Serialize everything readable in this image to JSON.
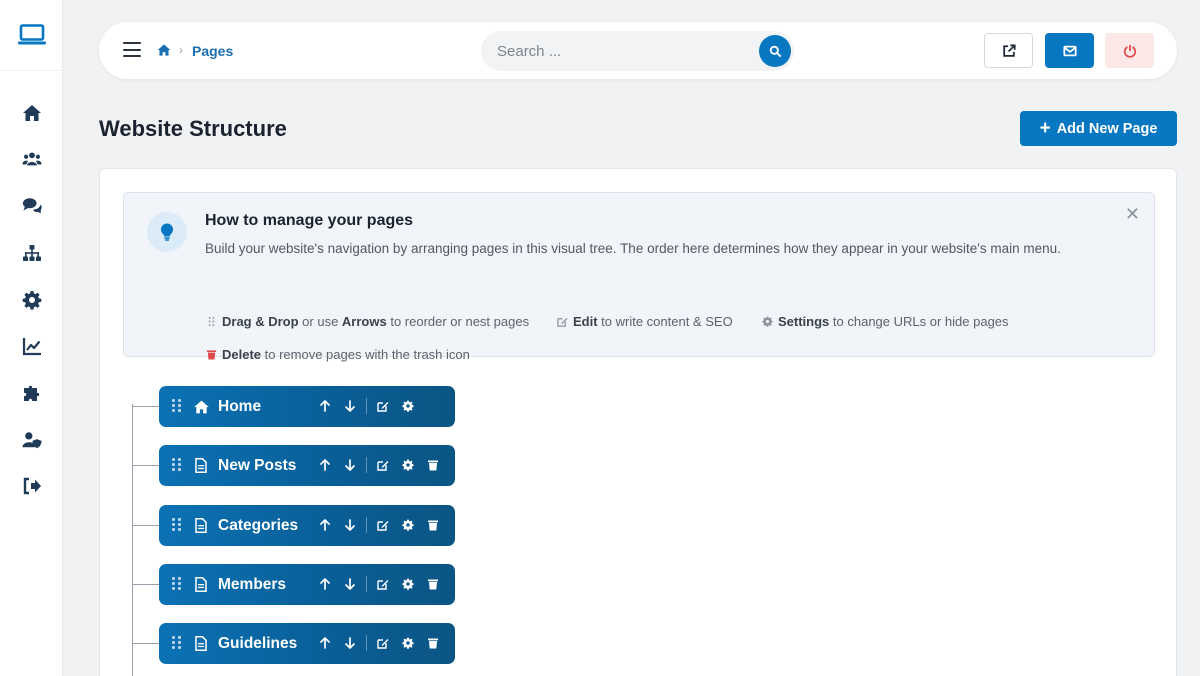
{
  "breadcrumb": {
    "current": "Pages"
  },
  "search": {
    "placeholder": "Search ..."
  },
  "header": {
    "title": "Website Structure",
    "add_button": "Add New Page"
  },
  "info": {
    "title": "How to manage your pages",
    "description": "Build your website's navigation by arranging pages in this visual tree. The order here determines how they appear in your website's main menu.",
    "tips": [
      {
        "bold": "Drag & Drop",
        "mid": " or use ",
        "bold2": "Arrows",
        "rest": " to reorder or nest pages"
      },
      {
        "bold": "Edit",
        "rest": " to write content & SEO"
      },
      {
        "bold": "Settings",
        "rest": " to change URLs or hide pages"
      },
      {
        "bold": "Delete",
        "rest": " to remove pages with the trash icon"
      }
    ]
  },
  "pages": [
    {
      "label": "Home",
      "icon": "home-icon",
      "deletable": false
    },
    {
      "label": "New Posts",
      "icon": "file-icon",
      "deletable": true
    },
    {
      "label": "Categories",
      "icon": "file-icon",
      "deletable": true
    },
    {
      "label": "Members",
      "icon": "file-icon",
      "deletable": true
    },
    {
      "label": "Guidelines",
      "icon": "file-icon",
      "deletable": true
    }
  ],
  "colors": {
    "primary": "#0877c1",
    "node": "#0a5f98",
    "danger": "#e04a4a"
  }
}
